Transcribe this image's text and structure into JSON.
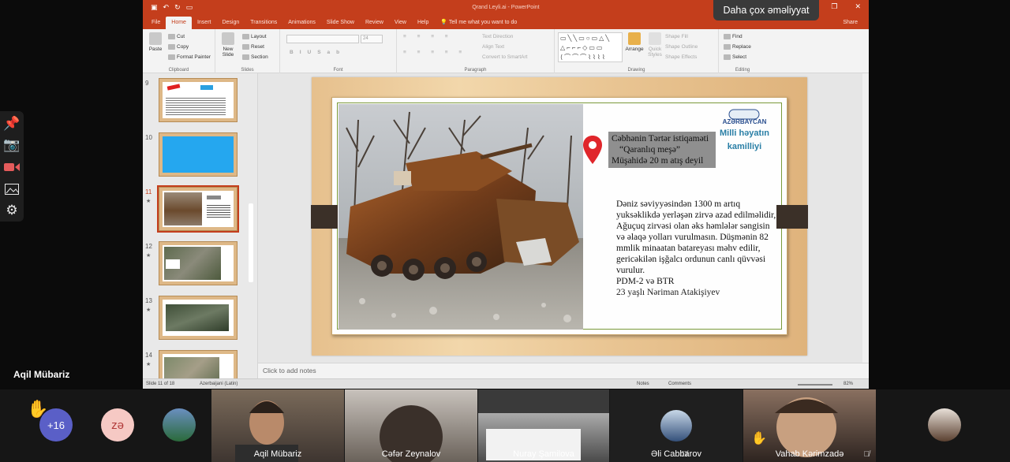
{
  "presenter": {
    "name": "Aqil Mübariz"
  },
  "side_tools": [
    "pin-icon",
    "camera-icon",
    "video-icon",
    "gallery-icon",
    "gear-icon"
  ],
  "tooltip": "Daha çox əməliyyat",
  "ppt": {
    "window_title": "Qrand Leyli.ai - PowerPoint",
    "tabs": [
      "File",
      "Home",
      "Insert",
      "Design",
      "Transitions",
      "Animations",
      "Slide Show",
      "Review",
      "View",
      "Help"
    ],
    "active_tab": "Home",
    "tell_me": "Tell me what you want to do",
    "share": "Share",
    "ribbon": {
      "clipboard": {
        "label": "Clipboard",
        "paste": "Paste",
        "cut": "Cut",
        "copy": "Copy",
        "format_painter": "Format Painter"
      },
      "slides": {
        "label": "Slides",
        "new_slide": "New Slide",
        "layout": "Layout",
        "reset": "Reset",
        "section": "Section"
      },
      "font": {
        "label": "Font",
        "size": "24"
      },
      "paragraph": {
        "label": "Paragraph",
        "text_direction": "Text Direction",
        "align_text": "Align Text",
        "smartart": "Convert to SmartArt"
      },
      "drawing": {
        "label": "Drawing",
        "arrange": "Arrange",
        "quick_styles": "Quick Styles",
        "shape_fill": "Shape Fill",
        "shape_outline": "Shape Outline",
        "shape_effects": "Shape Effects"
      },
      "editing": {
        "label": "Editing",
        "find": "Find",
        "replace": "Replace",
        "select": "Select"
      }
    },
    "thumbnails": [
      {
        "num": "9",
        "star": ""
      },
      {
        "num": "10",
        "star": ""
      },
      {
        "num": "11",
        "star": "★"
      },
      {
        "num": "12",
        "star": "★"
      },
      {
        "num": "13",
        "star": "★"
      },
      {
        "num": "14",
        "star": "★"
      }
    ],
    "slide": {
      "callout_line1": "Cəbhənin Tərtər istiqaməti",
      "callout_line2": "“Qaranlıq meşə”",
      "callout_line3": "Müşahidə 20 m atış deyil",
      "logo_mark": "AZƏRBAYCAN",
      "logo_line1": "Milli həyatın",
      "logo_line2": "kamilliyi",
      "body": "Dəniz səviyyəsindən 1300 m artıq yuksəklikdə yerləşən zirvə azad edilməlidir, Ağuçuq zirvəsi olan əks həmlələr səngisin və əlaqə yolları vurulmasın. Düşmənin 82 mmlik minaatan batareyası məhv edilir, gericəkilən işğalcı ordunun canlı qüvvəsi vurulur.",
      "vehicles": "PDM-2 və BTR",
      "author": "23 yaşlı Nəriman Atakişiyev"
    },
    "notes_placeholder": "Click to add notes",
    "status": {
      "slide_count": "Slide 11 of 18",
      "language": "Azerbaijani (Latin)",
      "notes": "Notes",
      "comments": "Comments",
      "zoom": "82%"
    }
  },
  "participants": {
    "raised_count": "+16",
    "avatar_initials": "zə",
    "tiles": [
      {
        "name": "Aqil Mübariz"
      },
      {
        "name": "Cəfər Zeynalov"
      },
      {
        "name": "Nuray Şamilova"
      },
      {
        "name": "Əli Cabbarov"
      },
      {
        "name": "Vahab Kərimzadə"
      }
    ]
  },
  "colors": {
    "ppt_accent": "#c43e1c",
    "avatar_pink": "#f6c9c4",
    "raised_purple": "#5a5fc7"
  }
}
